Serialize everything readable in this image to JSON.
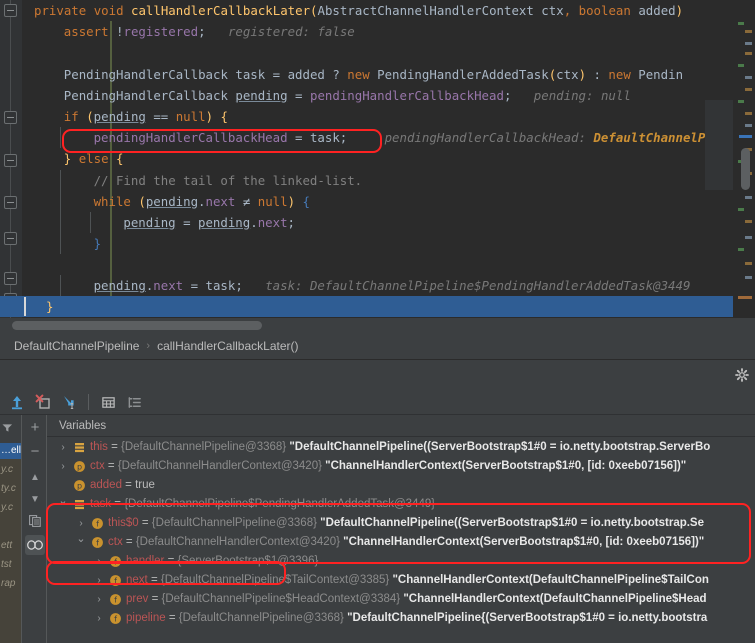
{
  "editor": {
    "language": "java",
    "lines": [
      {
        "id": "l1",
        "tokens": [
          {
            "t": "private ",
            "c": "kw"
          },
          {
            "t": "void ",
            "c": "kw"
          },
          {
            "t": "callHandlerCallbackLater",
            "c": "fn"
          },
          {
            "t": "(",
            "c": "yel"
          },
          {
            "t": "AbstractChannelHandlerContext ctx",
            "c": "typ"
          },
          {
            "t": ", ",
            "c": "kw"
          },
          {
            "t": "boolean ",
            "c": "kw"
          },
          {
            "t": "added",
            "c": "typ"
          },
          {
            "t": ")",
            "c": "yel"
          }
        ]
      },
      {
        "id": "l2",
        "indent": 1,
        "tokens": [
          {
            "t": "assert ",
            "c": "kw"
          },
          {
            "t": "!",
            "c": "typ"
          },
          {
            "t": "registered",
            "c": "fld"
          },
          {
            "t": ";",
            "c": "typ"
          },
          {
            "t": "   registered: false",
            "c": "hint"
          }
        ]
      },
      {
        "id": "l3",
        "tokens": []
      },
      {
        "id": "l4",
        "indent": 1,
        "tokens": [
          {
            "t": "PendingHandlerCallback task = added ? ",
            "c": "typ"
          },
          {
            "t": "new ",
            "c": "kw"
          },
          {
            "t": "PendingHandlerAddedTask",
            "c": "typ"
          },
          {
            "t": "(",
            "c": "yel"
          },
          {
            "t": "ctx",
            "c": "typ"
          },
          {
            "t": ")",
            "c": "yel"
          },
          {
            "t": " : ",
            "c": "typ"
          },
          {
            "t": "new ",
            "c": "kw"
          },
          {
            "t": "Pendin",
            "c": "typ"
          }
        ]
      },
      {
        "id": "l5",
        "indent": 1,
        "tokens": [
          {
            "t": "PendingHandlerCallback ",
            "c": "typ"
          },
          {
            "t": "pending",
            "c": "locu"
          },
          {
            "t": " = ",
            "c": "typ"
          },
          {
            "t": "pendingHandlerCallbackHead",
            "c": "fld"
          },
          {
            "t": ";",
            "c": "typ"
          },
          {
            "t": "   pending: null",
            "c": "hint"
          }
        ]
      },
      {
        "id": "l6",
        "indent": 1,
        "tokens": [
          {
            "t": "if ",
            "c": "kw"
          },
          {
            "t": "(",
            "c": "yel"
          },
          {
            "t": "pending",
            "c": "locu"
          },
          {
            "t": " == ",
            "c": "typ"
          },
          {
            "t": "null",
            "c": "kw"
          },
          {
            "t": ")",
            "c": "yel"
          },
          {
            "t": " {",
            "c": "yel"
          }
        ]
      },
      {
        "id": "l7",
        "indent": 2,
        "tokens": [
          {
            "t": "pendingHandlerCallbackHead",
            "c": "fld"
          },
          {
            "t": " = ",
            "c": "typ"
          },
          {
            "t": "task",
            "c": "typ"
          },
          {
            "t": ";",
            "c": "typ"
          },
          {
            "t": "     pendingHandlerCallbackHead: ",
            "c": "hint"
          },
          {
            "t": "DefaultChannelP",
            "c": "hintv"
          }
        ]
      },
      {
        "id": "l8",
        "indent": 1,
        "tokens": [
          {
            "t": "} ",
            "c": "yel"
          },
          {
            "t": "else ",
            "c": "kw"
          },
          {
            "t": "{",
            "c": "yel"
          }
        ]
      },
      {
        "id": "l9",
        "indent": 2,
        "tokens": [
          {
            "t": "// Find the tail of the linked-list.",
            "c": "cmt"
          }
        ]
      },
      {
        "id": "l10",
        "indent": 2,
        "tokens": [
          {
            "t": "while ",
            "c": "kw"
          },
          {
            "t": "(",
            "c": "yel"
          },
          {
            "t": "pending",
            "c": "locu"
          },
          {
            "t": ".",
            "c": "typ"
          },
          {
            "t": "next",
            "c": "fld"
          },
          {
            "t": " ≠ ",
            "c": "typ"
          },
          {
            "t": "null",
            "c": "kw"
          },
          {
            "t": ")",
            "c": "yel"
          },
          {
            "t": " {",
            "c": "blu"
          }
        ]
      },
      {
        "id": "l11",
        "indent": 3,
        "tokens": [
          {
            "t": "pending",
            "c": "locu"
          },
          {
            "t": " = ",
            "c": "typ"
          },
          {
            "t": "pending",
            "c": "locu"
          },
          {
            "t": ".",
            "c": "typ"
          },
          {
            "t": "next",
            "c": "fld"
          },
          {
            "t": ";",
            "c": "typ"
          }
        ]
      },
      {
        "id": "l12",
        "indent": 2,
        "tokens": [
          {
            "t": "}",
            "c": "blu"
          }
        ]
      },
      {
        "id": "l13",
        "tokens": []
      },
      {
        "id": "l14",
        "indent": 2,
        "tokens": [
          {
            "t": "pending",
            "c": "locu"
          },
          {
            "t": ".",
            "c": "typ"
          },
          {
            "t": "next",
            "c": "fld"
          },
          {
            "t": " = ",
            "c": "typ"
          },
          {
            "t": "task",
            "c": "typ"
          },
          {
            "t": ";",
            "c": "typ"
          },
          {
            "t": "   task: ",
            "c": "hint"
          },
          {
            "t": "DefaultChannelPipeline$PendingHandlerAddedTask@3449",
            "c": "hint"
          }
        ]
      },
      {
        "id": "l15",
        "indent": 1,
        "tokens": [
          {
            "t": "}",
            "c": "yel"
          }
        ]
      },
      {
        "id": "l16",
        "indent": 0,
        "exec": true,
        "tokens": [
          {
            "t": "    }",
            "c": "yel"
          }
        ]
      }
    ]
  },
  "breadcrumb": {
    "items": [
      "DefaultChannelPipeline",
      "callHandlerCallbackLater()"
    ],
    "separator": "›"
  },
  "debug_toolbar": {
    "buttons": [
      {
        "name": "step-out-icon",
        "label": "Step Out"
      },
      {
        "name": "drop-frame-icon",
        "label": "Drop Frame"
      },
      {
        "name": "run-to-cursor-icon",
        "label": "Run to Cursor"
      },
      {
        "name": "evaluate-expression-icon",
        "label": "Evaluate Expression"
      },
      {
        "name": "show-execution-point-icon",
        "label": "Show Execution Point"
      }
    ]
  },
  "variables_panel": {
    "title": "Variables",
    "side_buttons": [
      {
        "name": "add-watch-button",
        "glyph": "+"
      },
      {
        "name": "remove-watch-button",
        "glyph": "−"
      },
      {
        "name": "move-up-button",
        "glyph": "▲"
      },
      {
        "name": "move-down-button",
        "glyph": "▼"
      },
      {
        "name": "copy-value-button",
        "glyph": "⎘"
      },
      {
        "name": "inspect-button",
        "glyph": "∞"
      }
    ],
    "rows": [
      {
        "id": "r-this",
        "depth": 0,
        "expandable": true,
        "expanded": false,
        "icon": "field-group-icon",
        "icon_kind": "local",
        "name": "this",
        "eq": " = ",
        "ref": "{DefaultChannelPipeline@3368}",
        "value": "\"DefaultChannelPipeline((ServerBootstrap$1#0 = io.netty.bootstrap.ServerBo",
        "highlight": false
      },
      {
        "id": "r-ctx",
        "depth": 0,
        "expandable": true,
        "expanded": false,
        "icon": "parameter-icon",
        "icon_kind": "param",
        "name": "ctx",
        "eq": " = ",
        "ref": "{DefaultChannelHandlerContext@3420}",
        "value": "\"ChannelHandlerContext(ServerBootstrap$1#0, [id: 0xeeb07156])\"",
        "highlight": false
      },
      {
        "id": "r-added",
        "depth": 0,
        "expandable": false,
        "expanded": false,
        "icon": "parameter-icon",
        "icon_kind": "param",
        "name": "added",
        "eq": " = ",
        "ref": "",
        "value": "true",
        "value_plain": true,
        "highlight": false
      },
      {
        "id": "r-task",
        "depth": 0,
        "expandable": true,
        "expanded": true,
        "icon": "field-group-icon",
        "icon_kind": "local",
        "name": "task",
        "eq": " = ",
        "ref": "{DefaultChannelPipeline$PendingHandlerAddedTask@3449}",
        "value": "",
        "highlight": true
      },
      {
        "id": "r-this0",
        "depth": 1,
        "expandable": true,
        "expanded": false,
        "icon": "field-icon",
        "icon_kind": "field",
        "name": "this$0",
        "eq": " = ",
        "ref": "{DefaultChannelPipeline@3368}",
        "value": "\"DefaultChannelPipeline((ServerBootstrap$1#0 = io.netty.bootstrap.Se",
        "highlight": true
      },
      {
        "id": "r-task-ctx",
        "depth": 1,
        "expandable": true,
        "expanded": true,
        "icon": "field-icon",
        "icon_kind": "field",
        "name": "ctx",
        "eq": " = ",
        "ref": "{DefaultChannelHandlerContext@3420}",
        "value": "\"ChannelHandlerContext(ServerBootstrap$1#0, [id: 0xeeb07156])\"",
        "highlight": true
      },
      {
        "id": "r-handler",
        "depth": 2,
        "expandable": true,
        "expanded": false,
        "icon": "field-icon",
        "icon_kind": "field",
        "name": "handler",
        "eq": " = ",
        "ref": "{ServerBootstrap$1@3396}",
        "value": "",
        "highlight": true
      },
      {
        "id": "r-next",
        "depth": 2,
        "expandable": true,
        "expanded": false,
        "icon": "field-icon",
        "icon_kind": "field",
        "name": "next",
        "eq": " = ",
        "ref": "{DefaultChannelPipeline$TailContext@3385}",
        "value": "\"ChannelHandlerContext(DefaultChannelPipeline$TailCon",
        "highlight": false
      },
      {
        "id": "r-prev",
        "depth": 2,
        "expandable": true,
        "expanded": false,
        "icon": "field-icon",
        "icon_kind": "field",
        "name": "prev",
        "eq": " = ",
        "ref": "{DefaultChannelPipeline$HeadContext@3384}",
        "value": "\"ChannelHandlerContext(DefaultChannelPipeline$Head",
        "highlight": false
      },
      {
        "id": "r-pipeline",
        "depth": 2,
        "expandable": true,
        "expanded": false,
        "icon": "field-icon",
        "icon_kind": "field",
        "name": "pipeline",
        "eq": " = ",
        "ref": "{DefaultChannelPipeline@3368}",
        "value": "\"DefaultChannelPipeline{(ServerBootstrap$1#0 = io.netty.bootstra",
        "highlight": false
      }
    ]
  },
  "frames_peek": {
    "rows": [
      {
        "text": "…ell",
        "selected": true
      },
      {
        "text": "y.c",
        "selected": false
      },
      {
        "text": "ty.c",
        "selected": false
      },
      {
        "text": "y.c",
        "selected": false
      },
      {
        "text": "",
        "selected": false
      },
      {
        "text": "ett",
        "selected": false
      },
      {
        "text": "tst",
        "selected": false
      },
      {
        "text": "rap",
        "selected": false
      }
    ]
  },
  "colors": {
    "editor_bg": "#2b2b2b",
    "panel_bg": "#3c3f41",
    "gutter_bg": "#313335",
    "exec_line": "#2f5d94",
    "annotation_red": "#ff2222",
    "keyword": "#cc7832",
    "method": "#ffc66d",
    "field": "#9876aa",
    "comment": "#808080",
    "hint": "#787878",
    "hint_value": "#cc9034",
    "var_name": "#bb5555",
    "var_ref": "#8c8c8c"
  }
}
